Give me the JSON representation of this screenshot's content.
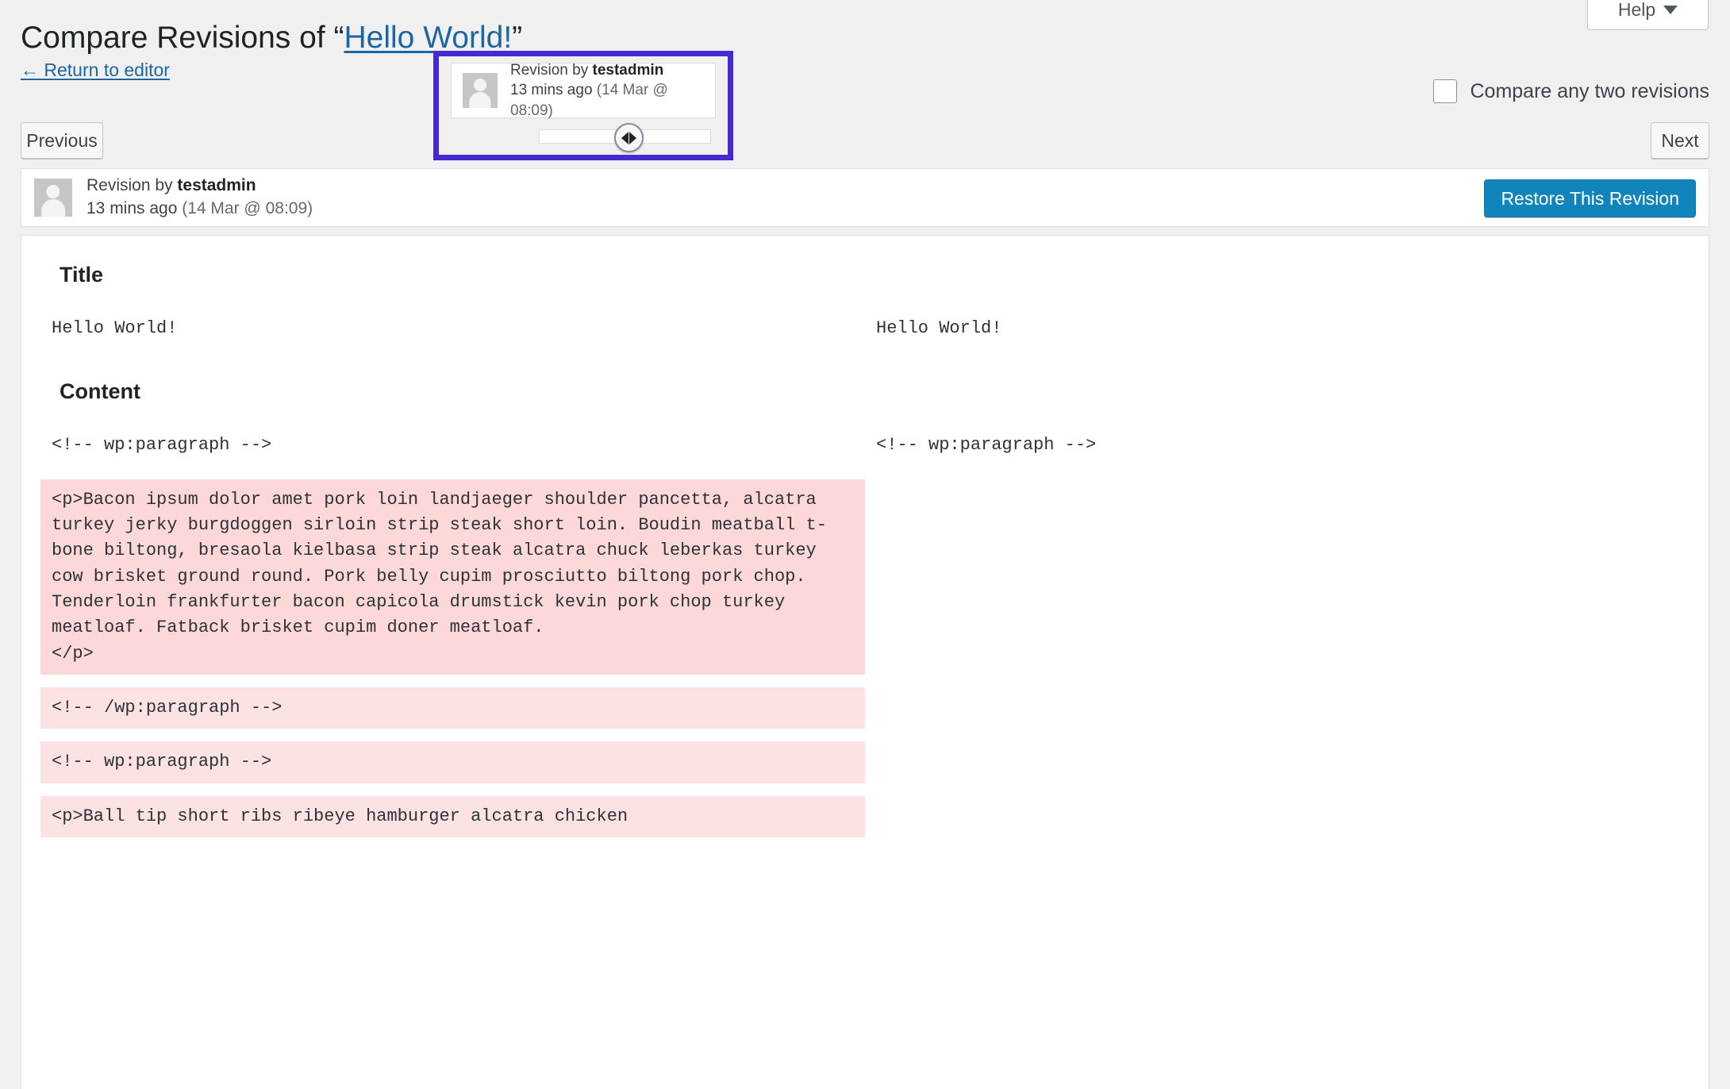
{
  "header": {
    "help_label": "Help",
    "title_prefix": "Compare Revisions of “",
    "title_link": "Hello World!",
    "title_suffix": "”",
    "return_link": "← Return to editor",
    "compare_any_label": "Compare any two revisions"
  },
  "nav": {
    "previous_label": "Previous",
    "next_label": "Next"
  },
  "slider_tooltip": {
    "revision_by_prefix": "Revision by ",
    "author": "testadmin",
    "time_ago": "13 mins ago ",
    "timestamp": "(14 Mar @ 08:09)"
  },
  "revision_bar": {
    "revision_by_prefix": "Revision by ",
    "author": "testadmin",
    "time_ago": "13 mins ago ",
    "timestamp": "(14 Mar @ 08:09)",
    "restore_label": "Restore This Revision"
  },
  "diff": {
    "title_heading": "Title",
    "content_heading": "Content",
    "title_left": "Hello World!",
    "title_right": "Hello World!",
    "content_rows": [
      {
        "left": "<!-- wp:paragraph -->",
        "right": "<!-- wp:paragraph -->",
        "left_state": "none",
        "right_state": "none"
      },
      {
        "left": "<p>Bacon ipsum dolor amet pork loin landjaeger shoulder pancetta, alcatra turkey jerky burgdoggen sirloin strip steak short loin. Boudin meatball t-bone biltong, bresaola kielbasa strip steak alcatra chuck leberkas turkey cow brisket ground round. Pork belly cupim prosciutto biltong pork chop. Tenderloin frankfurter bacon capicola drumstick kevin pork chop turkey meatloaf. Fatback brisket cupim doner meatloaf.\n</p>",
        "right": "",
        "left_state": "deleted",
        "right_state": "none"
      },
      {
        "left": "<!-- /wp:paragraph -->",
        "right": "",
        "left_state": "deleted-soft",
        "right_state": "none"
      },
      {
        "left": "<!-- wp:paragraph -->",
        "right": "",
        "left_state": "deleted-soft",
        "right_state": "none"
      },
      {
        "left": "<p>Ball tip short ribs ribeye hamburger alcatra chicken",
        "right": "",
        "left_state": "deleted-soft",
        "right_state": "none"
      }
    ]
  },
  "colors": {
    "highlight_purple": "#4729d1",
    "restore_blue": "#1184bb",
    "link_blue": "#1d66a1",
    "deleted_bg": "#fdd8d8",
    "page_bg": "#f0f0f1"
  }
}
